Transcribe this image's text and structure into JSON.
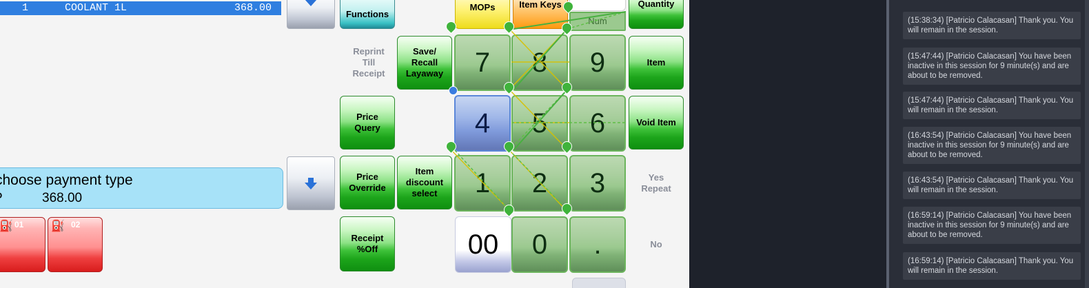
{
  "transaction": {
    "line": {
      "qty": "1",
      "description": "COOLANT 1L",
      "amount": "368.00"
    }
  },
  "buttons": {
    "functions": "Functions",
    "mops": "MOPs",
    "item_keys": "Item Keys",
    "quantity": "Quantity",
    "num": "Num",
    "reprint_line1": "Reprint",
    "reprint_line2": "Till",
    "reprint_line3": "Receipt",
    "save_recall_line1": "Save/",
    "save_recall_line2": "Recall",
    "save_recall_line3": "Layaway",
    "item": "Item",
    "price_query_line1": "Price",
    "price_query_line2": "Query",
    "void_item": "Void Item",
    "price_override_line1": "Price",
    "price_override_line2": "Override",
    "item_discount_line1": "Item",
    "item_discount_line2": "discount",
    "item_discount_line3": "select",
    "yes_repeat_line1": "Yes",
    "yes_repeat_line2": "Repeat",
    "receipt_off_line1": "Receipt",
    "receipt_off_line2": "%Off",
    "no": "No"
  },
  "keypad": {
    "k7": "7",
    "k8": "8",
    "k9": "9",
    "k4": "4",
    "k5": "5",
    "k6": "6",
    "k1": "1",
    "k2": "2",
    "k3": "3",
    "k00": "00",
    "k0": "0",
    "kdot": "."
  },
  "payment_prompt": {
    "message": "choose payment type",
    "prefix": "P",
    "amount": "368.00"
  },
  "pumps": [
    {
      "label": "01"
    },
    {
      "label": "02"
    }
  ],
  "chat": {
    "messages": [
      "(15:38:34) [Patricio Calacasan] Thank you. You will remain in the session.",
      "(15:47:44) [Patricio Calacasan] You have been inactive in this session for 9 minute(s) and are about to be removed.",
      "(15:47:44) [Patricio Calacasan] Thank you. You will remain in the session.",
      "(16:43:54) [Patricio Calacasan] You have been inactive in this session for 9 minute(s) and are about to be removed.",
      "(16:43:54) [Patricio Calacasan] Thank you. You will remain in the session.",
      "(16:59:14) [Patricio Calacasan] You have been inactive in this session for 9 minute(s) and are about to be removed.",
      "(16:59:14) [Patricio Calacasan] Thank you. You will remain in the session."
    ]
  },
  "colors": {
    "accent_blue": "#2f7fe0",
    "keypad_green": "#9bc98f",
    "selected_key": "#7f9adb",
    "chat_bg": "#2a2e38"
  }
}
